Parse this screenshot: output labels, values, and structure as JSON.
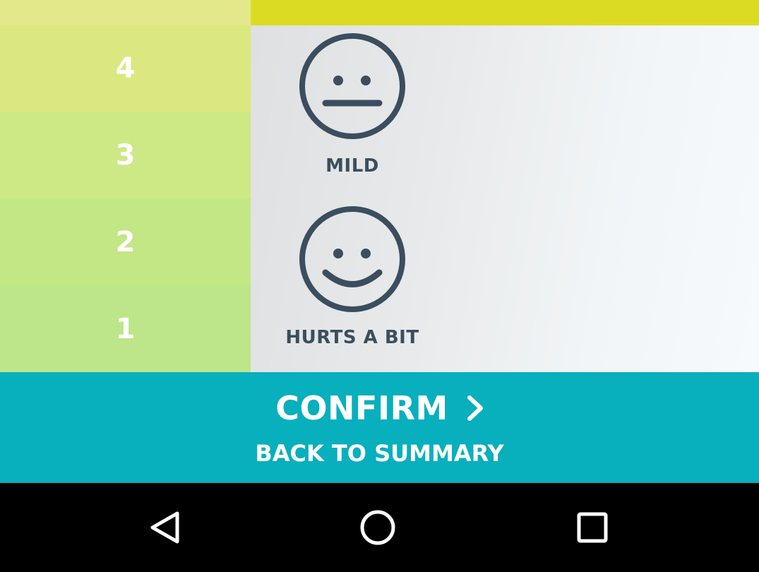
{
  "scale": {
    "levels": [
      {
        "value": "4"
      },
      {
        "value": "3"
      },
      {
        "value": "2"
      },
      {
        "value": "1"
      }
    ]
  },
  "faces": {
    "mild": {
      "label": "MILD",
      "icon": "neutral-face-icon"
    },
    "hurts_a_bit": {
      "label": "HURTS A BIT",
      "icon": "smiling-face-icon"
    }
  },
  "actions": {
    "confirm_label": "CONFIRM",
    "confirm_icon": "chevron-right-icon",
    "back_label": "BACK TO SUMMARY"
  },
  "navbar": {
    "back_icon": "nav-back-triangle-icon",
    "home_icon": "nav-home-circle-icon",
    "recents_icon": "nav-recents-square-icon"
  },
  "colors": {
    "header_yellow": "#dcdb24",
    "action_teal": "#08afbd",
    "face_stroke": "#3a4e5f",
    "scale_4": "#dbe87f",
    "scale_3": "#cce986",
    "scale_2": "#c3e785",
    "scale_1": "#bde589"
  }
}
